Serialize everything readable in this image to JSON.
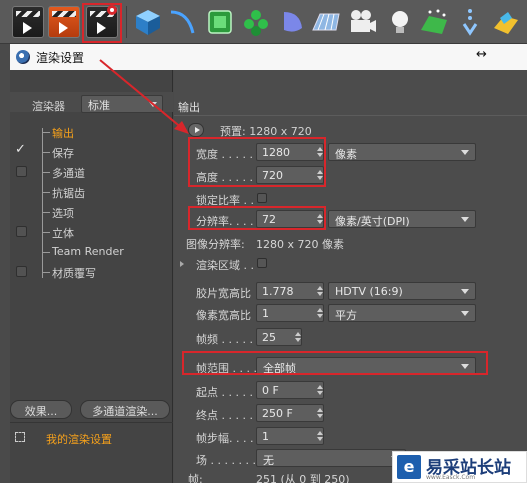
{
  "toolbar": {
    "icons": [
      "render-view-icon",
      "render-to-picture-viewer-icon",
      "edit-render-settings-icon",
      "cube-icon",
      "spline-icon",
      "generator-icon",
      "array-icon",
      "deformer-icon",
      "floor-icon",
      "camera-icon",
      "light-icon",
      "environment-icon",
      "effector-icon",
      "plane-tag-icon"
    ],
    "accent": "#d8262b"
  },
  "window": {
    "title": "渲染设置",
    "move_glyph": "↔"
  },
  "left": {
    "renderer_label": "渲染器",
    "renderer_value": "标准",
    "items": [
      {
        "label": "输出",
        "checkbox": false,
        "checked": false,
        "selected": true
      },
      {
        "label": "保存",
        "checkbox": true,
        "checked": true,
        "selected": false
      },
      {
        "label": "多通道",
        "checkbox": true,
        "checked": false,
        "selected": false
      },
      {
        "label": "抗锯齿",
        "checkbox": false,
        "checked": false,
        "selected": false
      },
      {
        "label": "选项",
        "checkbox": false,
        "checked": false,
        "selected": false
      },
      {
        "label": "立体",
        "checkbox": true,
        "checked": false,
        "selected": false
      },
      {
        "label": "Team Render",
        "checkbox": false,
        "checked": false,
        "selected": false
      },
      {
        "label": "材质覆写",
        "checkbox": true,
        "checked": false,
        "selected": false
      }
    ],
    "tick": "✓",
    "effect_button": "效果...",
    "multipass_button": "多通道渲染...",
    "my_settings": "我的渲染设置"
  },
  "output": {
    "section_title": "输出",
    "preset": "预置: 1280 x 720",
    "width_label": "宽度 . . . . .",
    "width_value": "1280",
    "height_label": "高度 . . . . .",
    "height_value": "720",
    "size_unit": "像素",
    "lock_ratio_label": "锁定比率 . .",
    "resolution_label": "分辨率. . . .",
    "resolution_value": "72",
    "resolution_unit": "像素/英寸(DPI)",
    "image_resolution_label": "图像分辨率:",
    "image_resolution_value": "1280 x 720 像素",
    "render_region_label": "渲染区域 . .",
    "film_aspect_label": "胶片宽高比",
    "film_aspect_value": "1.778",
    "film_aspect_preset": "HDTV (16:9)",
    "pixel_aspect_label": "像素宽高比",
    "pixel_aspect_value": "1",
    "pixel_aspect_preset": "平方",
    "fps_label": "帧频 . . . . .",
    "fps_value": "25",
    "frame_range_label": "帧范围 . . . .",
    "frame_range_value": "全部帧",
    "start_label": "起点 . . . . .",
    "start_value": "0 F",
    "end_label": "终点 . . . . .",
    "end_value": "250 F",
    "step_label": "帧步幅. . . .",
    "step_value": "1",
    "field_label": "场 . . . . . . .",
    "field_value": "无",
    "frames_label": "帧:",
    "frames_value": "251 (从 0 到 250)"
  },
  "watermark": {
    "logo": "e",
    "text": "易采站长站",
    "url": "www.Easck.Com"
  }
}
